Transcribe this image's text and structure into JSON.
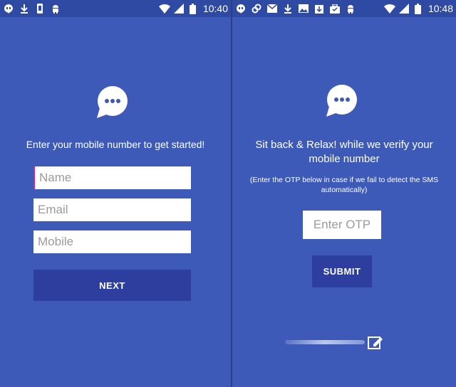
{
  "left": {
    "statusbar": {
      "time": "10:40"
    },
    "prompt": "Enter your mobile number to get started!",
    "fields": {
      "name_placeholder": "Name",
      "email_placeholder": "Email",
      "mobile_placeholder": "Mobile"
    },
    "next_label": "NEXT"
  },
  "right": {
    "statusbar": {
      "time": "10:48"
    },
    "heading": "Sit back & Relax! while we verify your mobile number",
    "subtext": "(Enter the OTP below in case if we fail to detect the SMS automatically)",
    "otp_placeholder": "Enter OTP",
    "submit_label": "SUBMIT"
  },
  "colors": {
    "background": "#3d5ab8",
    "statusbar": "#2f4aa3",
    "button": "#2d3e9e",
    "field": "#ffffff"
  }
}
